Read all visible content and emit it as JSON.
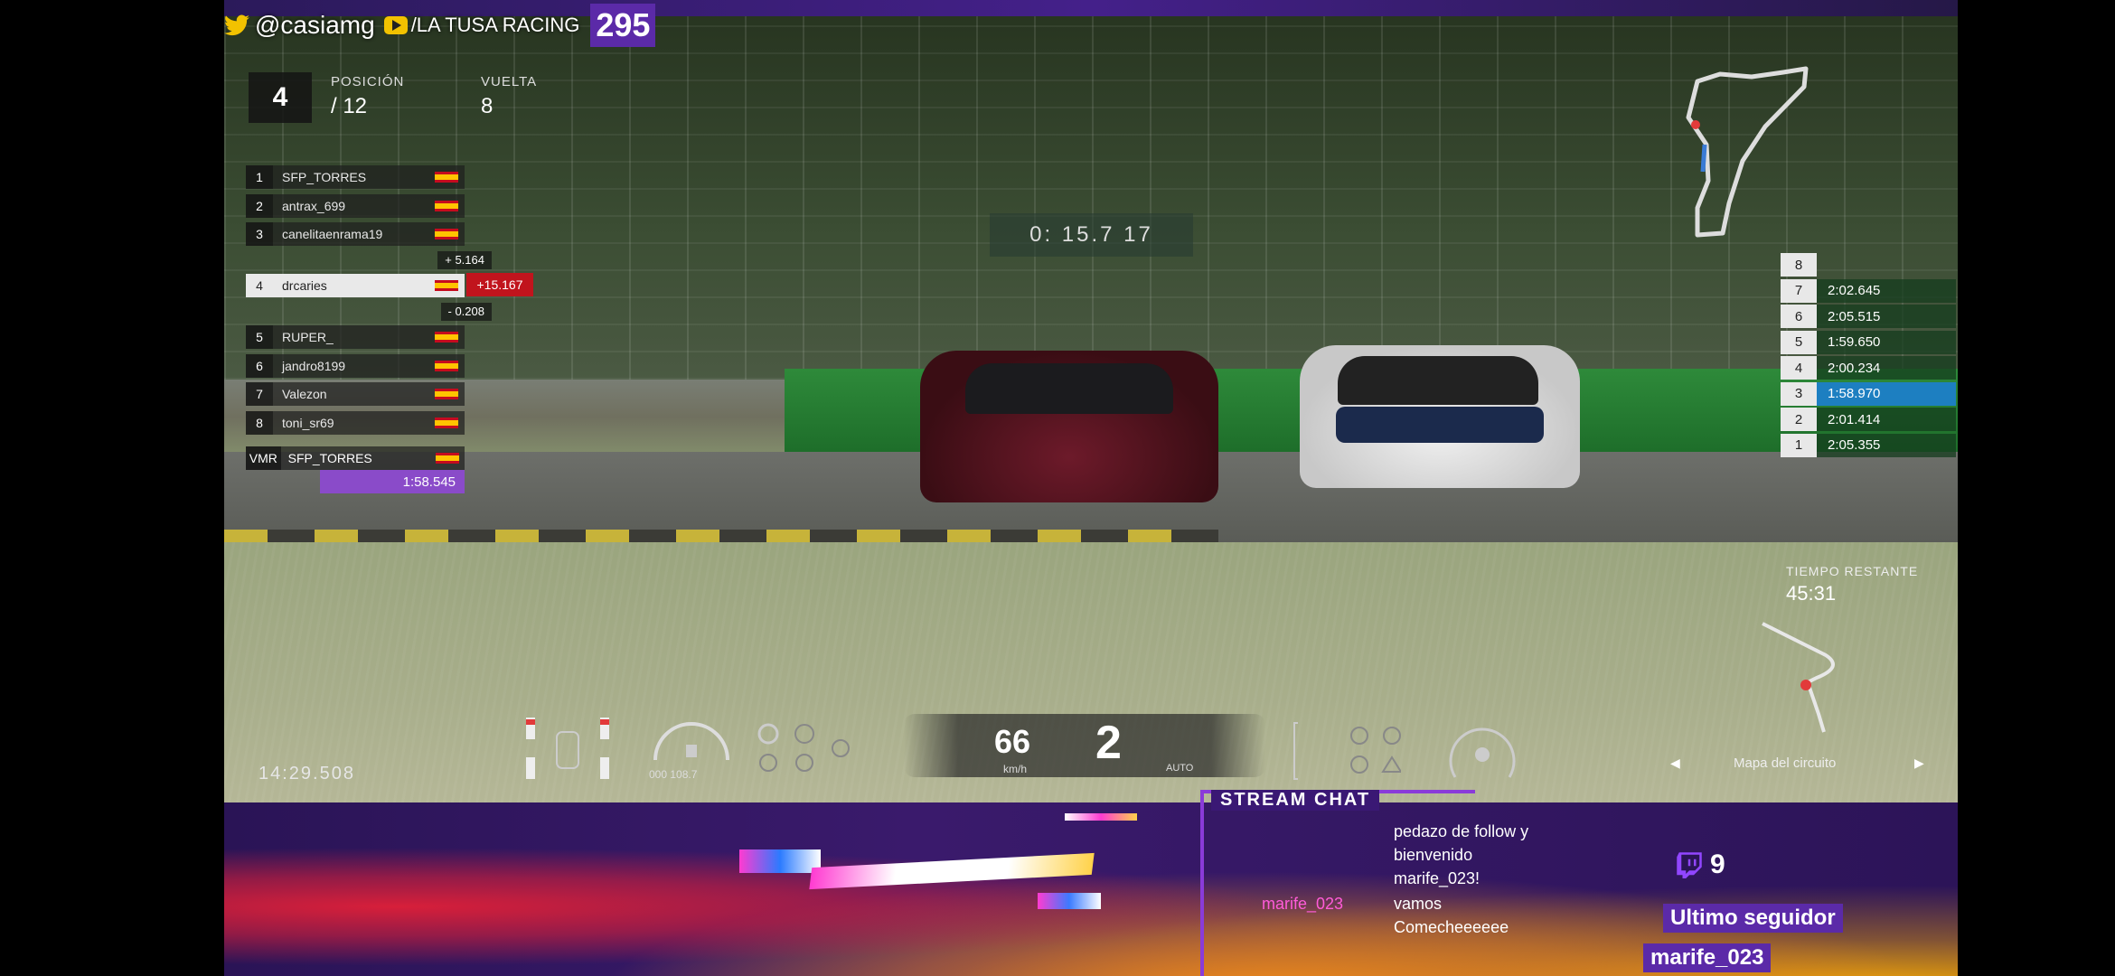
{
  "overlay": {
    "twitter_handle": "@casiamg",
    "team": "/LA TUSA RACING",
    "count": "295"
  },
  "hud": {
    "position_label": "POSICIÓN",
    "position_current": "4",
    "position_total": "/ 12",
    "lap_label": "VUELTA",
    "lap_value": "8",
    "lap_timer": "0: 15.7 17",
    "clock": "14:29.508",
    "speed": "66",
    "speed_unit": "km/h",
    "gear": "2",
    "gear_mode": "AUTO",
    "fuel_info": "000 108.7",
    "remaining_label": "TIEMPO RESTANTE",
    "remaining_value": "45:31",
    "map_label": "Mapa del circuito"
  },
  "leaderboard": [
    {
      "num": "1",
      "name": "SFP_TORRES"
    },
    {
      "num": "2",
      "name": "antrax_699"
    },
    {
      "num": "3",
      "name": "canelitaenrama19"
    },
    {
      "num": "4",
      "name": "drcaries",
      "gap_ahead": "+ 5.164",
      "gap_behind": "- 0.208",
      "gap_leader": "+15.167"
    },
    {
      "num": "5",
      "name": "RUPER_"
    },
    {
      "num": "6",
      "name": "jandro8199"
    },
    {
      "num": "7",
      "name": "Valezon"
    },
    {
      "num": "8",
      "name": "toni_sr69"
    }
  ],
  "vmr": {
    "tag": "VMR",
    "name": "SFP_TORRES",
    "time": "1:58.545"
  },
  "laps": [
    {
      "n": "8",
      "t": ""
    },
    {
      "n": "7",
      "t": "2:02.645"
    },
    {
      "n": "6",
      "t": "2:05.515"
    },
    {
      "n": "5",
      "t": "1:59.650"
    },
    {
      "n": "4",
      "t": "2:00.234"
    },
    {
      "n": "3",
      "t": "1:58.970"
    },
    {
      "n": "2",
      "t": "2:01.414"
    },
    {
      "n": "1",
      "t": "2:05.355"
    }
  ],
  "chat": {
    "title": "STREAM CHAT",
    "messages": [
      {
        "user": "",
        "lines": [
          "pedazo de follow y",
          "bienvenido",
          "marife_023!"
        ]
      },
      {
        "user": "marife_023",
        "lines": [
          "vamos",
          "Comecheeeeee"
        ]
      }
    ]
  },
  "stats": {
    "twitch_count": "9",
    "follower_label": "Ultimo seguidor",
    "follower_name": "marife_023"
  },
  "colors": {
    "twitch_purple": "#5b2aa8",
    "best_lap": "#1d7fc1",
    "gap_red": "#c1141d"
  }
}
